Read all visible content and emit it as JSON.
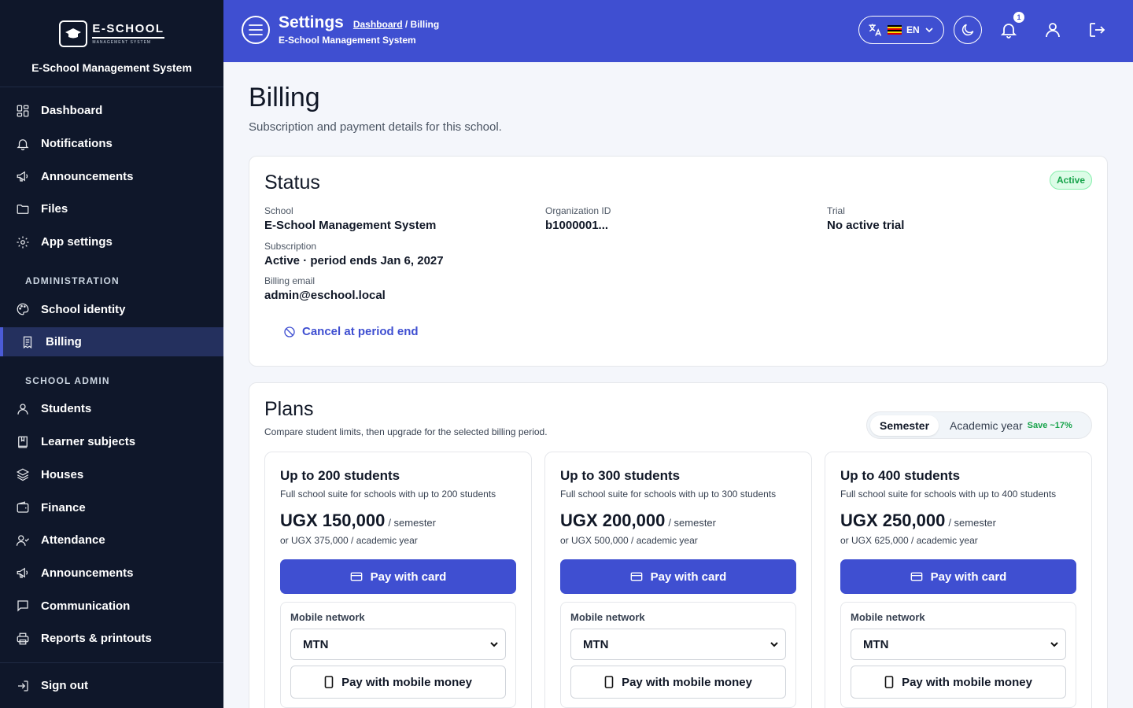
{
  "brand": {
    "logo_main": "E-SCHOOL",
    "logo_sub": "MANAGEMENT SYSTEM",
    "system_name": "E-School Management System"
  },
  "sidebar": {
    "items": [
      {
        "label": "Dashboard"
      },
      {
        "label": "Notifications"
      },
      {
        "label": "Announcements"
      },
      {
        "label": "Files"
      },
      {
        "label": "App settings"
      }
    ],
    "admin_section": "ADMINISTRATION",
    "admin_items": [
      {
        "label": "School identity"
      },
      {
        "label": "Billing"
      }
    ],
    "school_admin_section": "SCHOOL ADMIN",
    "school_admin_items": [
      {
        "label": "Students"
      },
      {
        "label": "Learner subjects"
      },
      {
        "label": "Houses"
      },
      {
        "label": "Finance"
      },
      {
        "label": "Attendance"
      },
      {
        "label": "Announcements"
      },
      {
        "label": "Communication"
      },
      {
        "label": "Reports & printouts"
      }
    ],
    "sign_out": "Sign out"
  },
  "header": {
    "title": "Settings",
    "breadcrumb_link": "Dashboard",
    "breadcrumb_sep": " / ",
    "breadcrumb_current": "Billing",
    "subtitle": "E-School Management System",
    "language": "EN",
    "notification_count": "1"
  },
  "page": {
    "title": "Billing",
    "subtitle": "Subscription and payment details for this school."
  },
  "status": {
    "heading": "Status",
    "badge": "Active",
    "school_label": "School",
    "school_value": "E-School Management System",
    "org_label": "Organization ID",
    "org_value": "b1000001...",
    "trial_label": "Trial",
    "trial_value": "No active trial",
    "subscription_label": "Subscription",
    "subscription_value": "Active · period ends Jan 6, 2027",
    "email_label": "Billing email",
    "email_value": "admin@eschool.local",
    "cancel_label": "Cancel at period end"
  },
  "plans": {
    "heading": "Plans",
    "description": "Compare student limits, then upgrade for the selected billing period.",
    "toggle_semester": "Semester",
    "toggle_year": "Academic year",
    "toggle_save": "Save ~17%",
    "mobile_label": "Mobile network",
    "pay_card_label": "Pay with card",
    "pay_mobile_label": "Pay with mobile money",
    "items": [
      {
        "name": "Up to 200 students",
        "desc": "Full school suite for schools with up to 200 students",
        "price": "UGX 150,000",
        "per": "/ semester",
        "alt": "or UGX 375,000 / academic year",
        "network": "MTN"
      },
      {
        "name": "Up to 300 students",
        "desc": "Full school suite for schools with up to 300 students",
        "price": "UGX 200,000",
        "per": "/ semester",
        "alt": "or UGX 500,000 / academic year",
        "network": "MTN"
      },
      {
        "name": "Up to 400 students",
        "desc": "Full school suite for schools with up to 400 students",
        "price": "UGX 250,000",
        "per": "/ semester",
        "alt": "or UGX 625,000 / academic year",
        "network": "MTN"
      }
    ]
  },
  "colors": {
    "primary": "#3f4fd1",
    "sidebar_bg": "#0f172a",
    "active_green": "#16a34a"
  }
}
